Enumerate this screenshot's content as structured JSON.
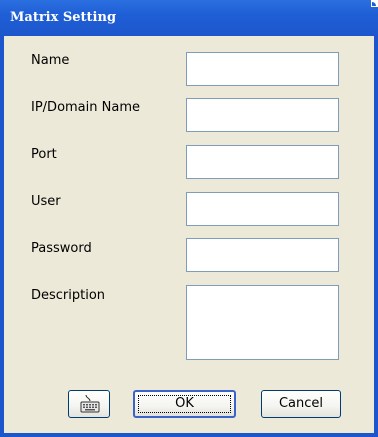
{
  "window": {
    "title": "Matrix Setting"
  },
  "form": {
    "fields": [
      {
        "label": "Name",
        "value": ""
      },
      {
        "label": "IP/Domain Name",
        "value": ""
      },
      {
        "label": "Port",
        "value": ""
      },
      {
        "label": "User",
        "value": ""
      },
      {
        "label": "Password",
        "value": ""
      },
      {
        "label": "Description",
        "value": ""
      }
    ]
  },
  "buttons": {
    "keyboard_icon": "keyboard-icon",
    "ok_label": "OK",
    "cancel_label": "Cancel"
  },
  "colors": {
    "titlebar": "#1f5fd6",
    "dialog_background": "#ece9d8",
    "field_border": "#7f9db9"
  }
}
